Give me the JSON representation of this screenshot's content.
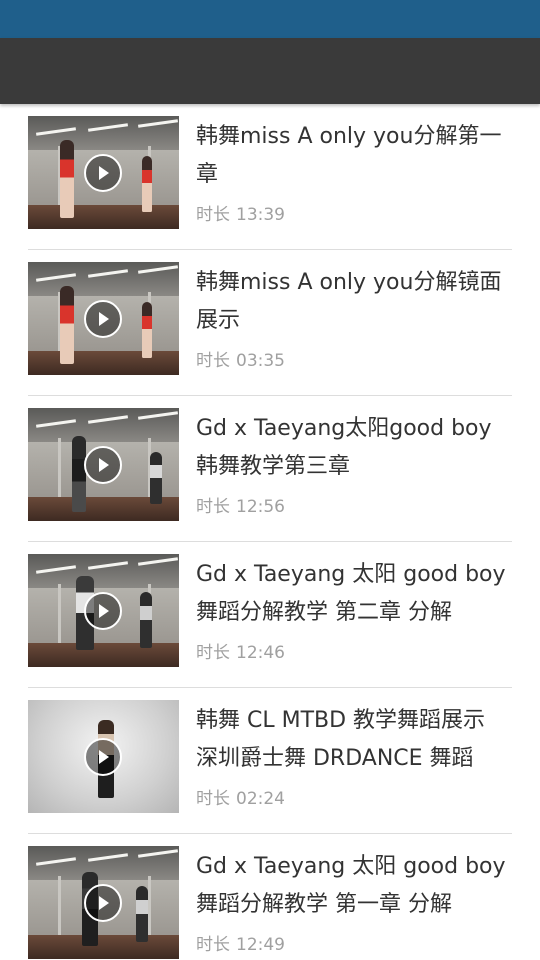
{
  "colors": {
    "status_bar": "#1f5f8b",
    "toolbar": "#3a3a3a",
    "title_text": "#333333",
    "meta_text": "#a0a0a0",
    "divider": "#dddddd"
  },
  "videos": [
    {
      "title": "韩舞miss A only you分解第一章",
      "duration_label": "时长",
      "duration": "13:39",
      "thumb_style": "studio-red"
    },
    {
      "title": "韩舞miss A only you分解镜面展示",
      "duration_label": "时长",
      "duration": "03:35",
      "thumb_style": "studio-red"
    },
    {
      "title": "Gd x Taeyang太阳good boy韩舞教学第三章",
      "duration_label": "时长",
      "duration": "12:56",
      "thumb_style": "studio-dark"
    },
    {
      "title": "Gd x Taeyang 太阳 good boy 舞蹈分解教学 第二章 分解",
      "duration_label": "时长",
      "duration": "12:46",
      "thumb_style": "studio-dark"
    },
    {
      "title": "韩舞 CL MTBD 教学舞蹈展示 深圳爵士舞 DRDANCE 舞蹈",
      "duration_label": "时长",
      "duration": "02:24",
      "thumb_style": "bright"
    },
    {
      "title": "Gd x Taeyang 太阳 good boy 舞蹈分解教学 第一章 分解",
      "duration_label": "时长",
      "duration": "12:49",
      "thumb_style": "studio-dark"
    }
  ]
}
